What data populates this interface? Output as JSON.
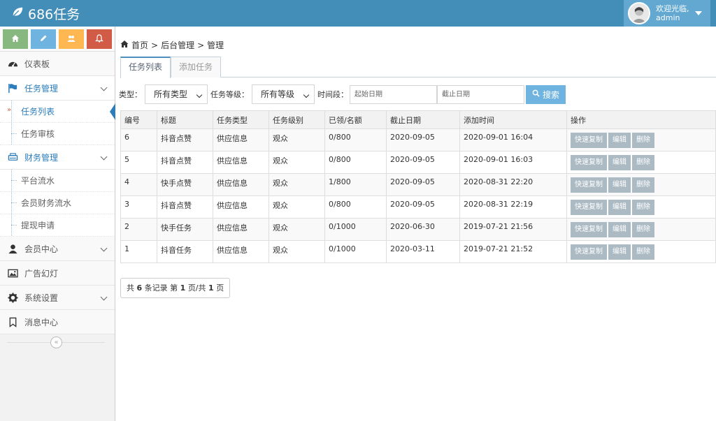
{
  "app": {
    "title": "686任务"
  },
  "user": {
    "greeting": "欢迎光临,",
    "name": "admin"
  },
  "sidebar": {
    "items": [
      {
        "label": "仪表板"
      },
      {
        "label": "任务管理",
        "children": [
          "任务列表",
          "任务审核"
        ]
      },
      {
        "label": "财务管理",
        "children": [
          "平台流水",
          "会员财务流水",
          "提现申请"
        ]
      },
      {
        "label": "会员中心"
      },
      {
        "label": "广告幻灯"
      },
      {
        "label": "系统设置"
      },
      {
        "label": "消息中心"
      }
    ],
    "collapse_glyph": "«"
  },
  "breadcrumb": {
    "home": "首页",
    "sep": ">",
    "section": "后台管理",
    "page": "管理"
  },
  "tabs": [
    "任务列表",
    "添加任务"
  ],
  "filters": {
    "type_label": "类型：",
    "type_value": "所有类型",
    "level_label": "任务等级：",
    "level_value": "所有等级",
    "period_label": "时间段：",
    "start_placeholder": "起始日期",
    "end_placeholder": "截止日期",
    "search_label": "搜索"
  },
  "table": {
    "headers": [
      "编号",
      "标题",
      "任务类型",
      "任务级别",
      "已领/名额",
      "截止日期",
      "添加时间",
      "操作"
    ],
    "rows": [
      [
        "6",
        "抖音点赞",
        "供应信息",
        "观众",
        "0/800",
        "2020-09-05",
        "2020-09-01 16:04"
      ],
      [
        "5",
        "抖音点赞",
        "供应信息",
        "观众",
        "0/800",
        "2020-09-05",
        "2020-09-01 16:03"
      ],
      [
        "4",
        "快手点赞",
        "供应信息",
        "观众",
        "1/800",
        "2020-09-05",
        "2020-08-31 22:20"
      ],
      [
        "3",
        "抖音点赞",
        "供应信息",
        "观众",
        "0/800",
        "2020-09-05",
        "2020-08-31 22:19"
      ],
      [
        "2",
        "快手任务",
        "供应信息",
        "观众",
        "0/1000",
        "2020-06-30",
        "2019-07-21 21:56"
      ],
      [
        "1",
        "抖音任务",
        "供应信息",
        "观众",
        "0/1000",
        "2020-03-11",
        "2019-07-21 21:52"
      ]
    ],
    "actions": [
      "快速复制",
      "编辑",
      "删除"
    ]
  },
  "pager": {
    "prefix": "共",
    "total": "6",
    "mid1": "条记录 第",
    "page": "1",
    "mid2": "页/共",
    "pages": "1",
    "suffix": "页"
  }
}
